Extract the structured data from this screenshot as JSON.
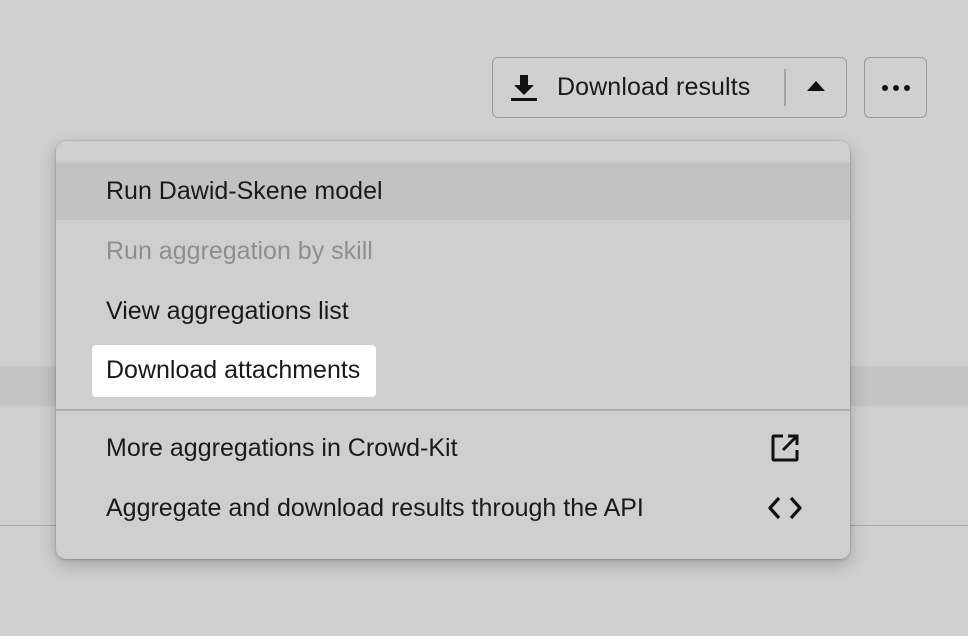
{
  "toolbar": {
    "download_label": "Download results",
    "download_icon": "download-icon",
    "toggle_icon": "caret-up-icon",
    "more_icon": "ellipsis-icon"
  },
  "menu": {
    "items": [
      {
        "label": "Run Dawid-Skene model",
        "state": "hovered"
      },
      {
        "label": "Run aggregation by skill",
        "state": "disabled"
      },
      {
        "label": "View aggregations list",
        "state": "normal"
      },
      {
        "label": "Download attachments",
        "state": "highlighted"
      }
    ],
    "links": [
      {
        "label": "More aggregations in Crowd-Kit",
        "icon": "external-link-icon"
      },
      {
        "label": "Aggregate and download results through the API",
        "icon": "code-icon"
      }
    ]
  },
  "colors": {
    "background": "#d0d0d0",
    "menu_background": "#cfcfcf",
    "hover_background": "#c2c2c2",
    "disabled_text": "#8e8e8e",
    "highlight_background": "#ffffff",
    "text": "#1a1a1a"
  }
}
